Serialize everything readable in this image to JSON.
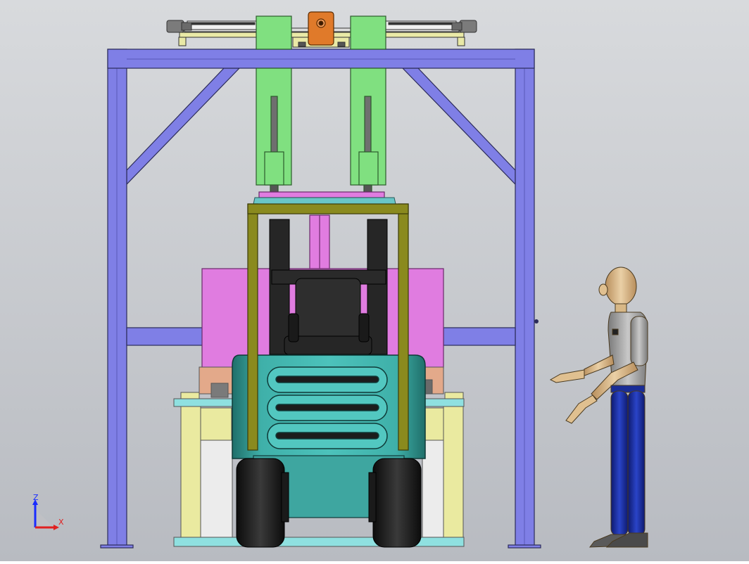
{
  "triad": {
    "z_label": "Z",
    "x_label": "X"
  },
  "colors": {
    "background_top": "#d4d6da",
    "background_bottom": "#b9bcc2",
    "frame": "#7f7fe6",
    "frame_stroke": "#2c2c5a",
    "cylinder_green": "#80e080",
    "rod": "#6f6f6f",
    "bracket_orange": "#e07a2a",
    "magenta_block": "#e07ce0",
    "forklift_teal": "#3ea6a0",
    "mast_olive": "#8a8a1e",
    "forks_black": "#262626",
    "wheel_black": "#1d1d1d",
    "base_cyan": "#8fe0e0",
    "base_yellow": "#eaeaa0",
    "base_salmon": "#e3a98a",
    "person_skin": "#e0c090",
    "person_shirt": "#a6a6a6",
    "person_pants": "#1a2d96",
    "person_shoes": "#5a5a5a",
    "triad_z": "#1a2cff",
    "triad_x": "#e02020"
  },
  "icons": [
    "coordinate-triad-icon"
  ]
}
